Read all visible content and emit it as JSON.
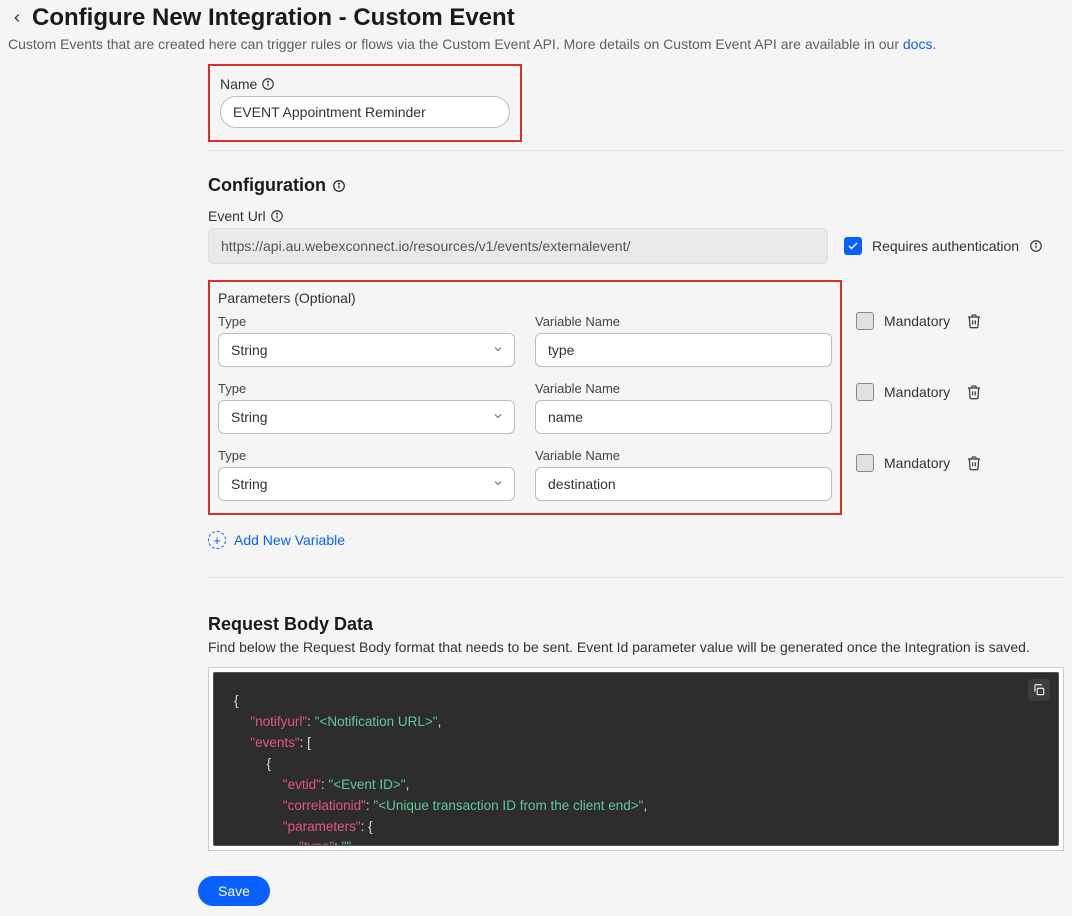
{
  "header": {
    "title": "Configure New Integration - Custom Event",
    "subtitle_prefix": "Custom Events that are created here can trigger rules or flows via the Custom Event API. More details on Custom Event API are available in our ",
    "docs_link_label": "docs",
    "subtitle_suffix": "."
  },
  "name_field": {
    "label": "Name",
    "value": "EVENT Appointment Reminder"
  },
  "config": {
    "heading": "Configuration",
    "event_url_label": "Event Url",
    "event_url_value": "https://api.au.webexconnect.io/resources/v1/events/externalevent/",
    "requires_auth_label": "Requires authentication",
    "requires_auth_checked": true
  },
  "params": {
    "heading": "Parameters (Optional)",
    "type_label": "Type",
    "varname_label": "Variable Name",
    "mandatory_label": "Mandatory",
    "rows": [
      {
        "type": "String",
        "varname": "type",
        "mandatory": false
      },
      {
        "type": "String",
        "varname": "name",
        "mandatory": false
      },
      {
        "type": "String",
        "varname": "destination",
        "mandatory": false
      }
    ],
    "add_label": "Add New Variable"
  },
  "body": {
    "heading": "Request Body Data",
    "desc": "Find below the Request Body format that needs to be sent. Event Id parameter value will be generated once the Integration is saved.",
    "code": {
      "keys": {
        "notifyurl": "notifyurl",
        "events": "events",
        "evtid": "evtid",
        "correlationid": "correlationid",
        "parameters": "parameters",
        "type": "type"
      },
      "values": {
        "notifyurl": "<Notification URL>",
        "evtid": "<Event ID>",
        "correlationid": "<Unique transaction ID from the client end>",
        "type": ""
      }
    }
  },
  "footer": {
    "save_label": "Save"
  }
}
